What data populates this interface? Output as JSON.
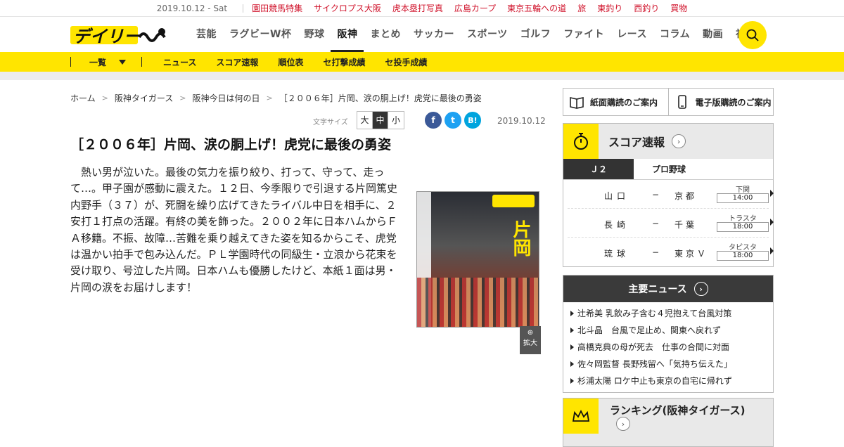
{
  "topbar": {
    "date": "2019.10.12 - Sat",
    "picks": [
      "園田競馬特集",
      "サイクロプス大阪",
      "虎本塁打写真",
      "広島カープ",
      "東京五輪への道",
      "旅",
      "東釣り",
      "西釣り",
      "買物"
    ]
  },
  "header": {
    "logo_text": "デイリー",
    "nav": [
      "芸能",
      "ラグビーW杯",
      "野球",
      "阪神",
      "まとめ",
      "サッカー",
      "スポーツ",
      "ゴルフ",
      "ファイト",
      "レース",
      "コラム",
      "動画",
      "社会"
    ],
    "active_nav": "阪神"
  },
  "subnav": {
    "list_label": "一覧",
    "items": [
      "ニュース",
      "スコア速報",
      "順位表",
      "セ打撃成績",
      "セ投手成績"
    ]
  },
  "breadcrumb": [
    "ホーム",
    "阪神タイガース",
    "阪神今日は何の日",
    "［２００６年］片岡、涙の胴上げ！虎党に最後の勇姿"
  ],
  "tools": {
    "font_size_label": "文字サイズ",
    "sizes": [
      "大",
      "中",
      "小"
    ],
    "selected_size": "中",
    "share": [
      "f",
      "t",
      "B!"
    ],
    "date": "2019.10.12"
  },
  "article": {
    "title": "［２００６年］片岡、涙の胴上げ！虎党に最後の勇姿",
    "body": "　熱い男が泣いた。最後の気力を振り絞り、打って、守って、走って…。甲子園が感動に震えた。１２日、今季限りで引退する片岡篤史内野手（３７）が、死闘を繰り広げてきたライバル中日を相手に、２安打１打点の活躍。有終の美を飾った。２００２年に日本ハムからＦＡ移籍。不振、故障…苦難を乗り越えてきた姿を知るからこそ、虎党は温かい拍手で包み込んだ。ＰＬ学園時代の同級生・立浪から花束を受け取り、号泣した片岡。日本ハムも優勝したけど、本紙１面は男・片岡の涙をお届けします！",
    "image_headline": "片岡",
    "zoom_label": "拡大"
  },
  "sidebar": {
    "subscribe": [
      "紙面購読のご案内",
      "電子版購読のご案内"
    ],
    "score": {
      "title": "スコア速報",
      "tabs": [
        "Ｊ２",
        "プロ野球"
      ],
      "active_tab": "Ｊ２",
      "matches": [
        {
          "home": "山口",
          "away": "京都",
          "venue": "下関",
          "time": "14:00"
        },
        {
          "home": "長崎",
          "away": "千葉",
          "venue": "トラスタ",
          "time": "18:00"
        },
        {
          "home": "琉球",
          "away": "東京Ｖ",
          "venue": "タピスタ",
          "time": "18:00"
        }
      ]
    },
    "news": {
      "title": "主要ニュース",
      "items": [
        "辻希美 乳飲み子含む４児抱えて台風対策",
        "北斗晶　台風で足止め、関東へ戻れず",
        "高橋克典の母が死去　仕事の合間に対面",
        "佐々岡監督 長野残留へ「気持ち伝えた」",
        "杉浦太陽 ロケ中止も東京の自宅に帰れず"
      ]
    },
    "ranking": {
      "title": "ランキング(阪神タイガース)"
    }
  },
  "colors": {
    "brand_yellow": "#ffe500",
    "pick_red": "#d0132b",
    "dark": "#3a3a3a"
  }
}
